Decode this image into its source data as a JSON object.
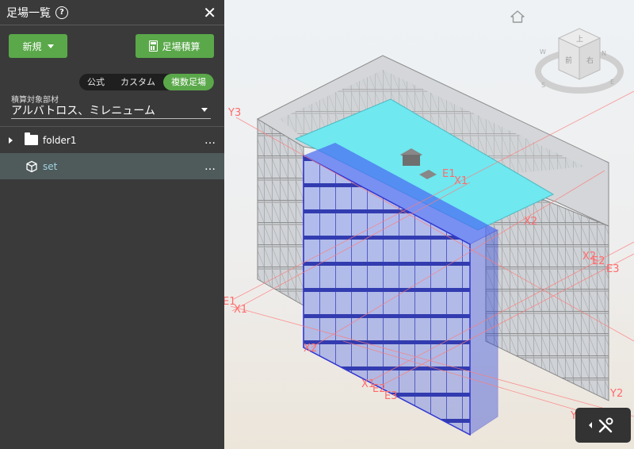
{
  "panel": {
    "title": "足場一覧",
    "help_icon": "?",
    "close_icon": "✕",
    "new_button": "新規",
    "estimate_button": "足場積算",
    "tabs": [
      {
        "label": "公式",
        "active": false
      },
      {
        "label": "カスタム",
        "active": false
      },
      {
        "label": "複数足場",
        "active": true
      }
    ],
    "member_label": "積算対象部材",
    "member_value": "アルバトロス、ミレニューム",
    "tree": [
      {
        "label": "folder1",
        "icon": "folder-icon",
        "more": "…"
      },
      {
        "label": "set",
        "icon": "cube-icon",
        "more": "…",
        "selected": true
      }
    ]
  },
  "viewport": {
    "axis_labels": {
      "y3": "Y3",
      "x1_top": "X1",
      "e1_top": "E1",
      "x2_mid": "X2",
      "x2_right": "X2",
      "e2_right": "E2",
      "e3_right": "E3",
      "e1_left": "E1",
      "x1_left": "X1",
      "x2_bottom": "X2",
      "x1_bottom": "X1",
      "e2_bottom": "E2",
      "e3_bottom": "E3",
      "y2": "Y2",
      "y_bottom": "Y"
    },
    "view_cube": {
      "top": "上",
      "front": "前",
      "right": "右",
      "compass": [
        "N",
        "E",
        "S",
        "W"
      ]
    }
  },
  "colors": {
    "accent_green": "#5aa84a",
    "panel_bg": "#3a3a3a",
    "axis_red": "#ff6b6b",
    "selection_blue": "#1a1acc",
    "roof_cyan": "#6fe8f0"
  }
}
